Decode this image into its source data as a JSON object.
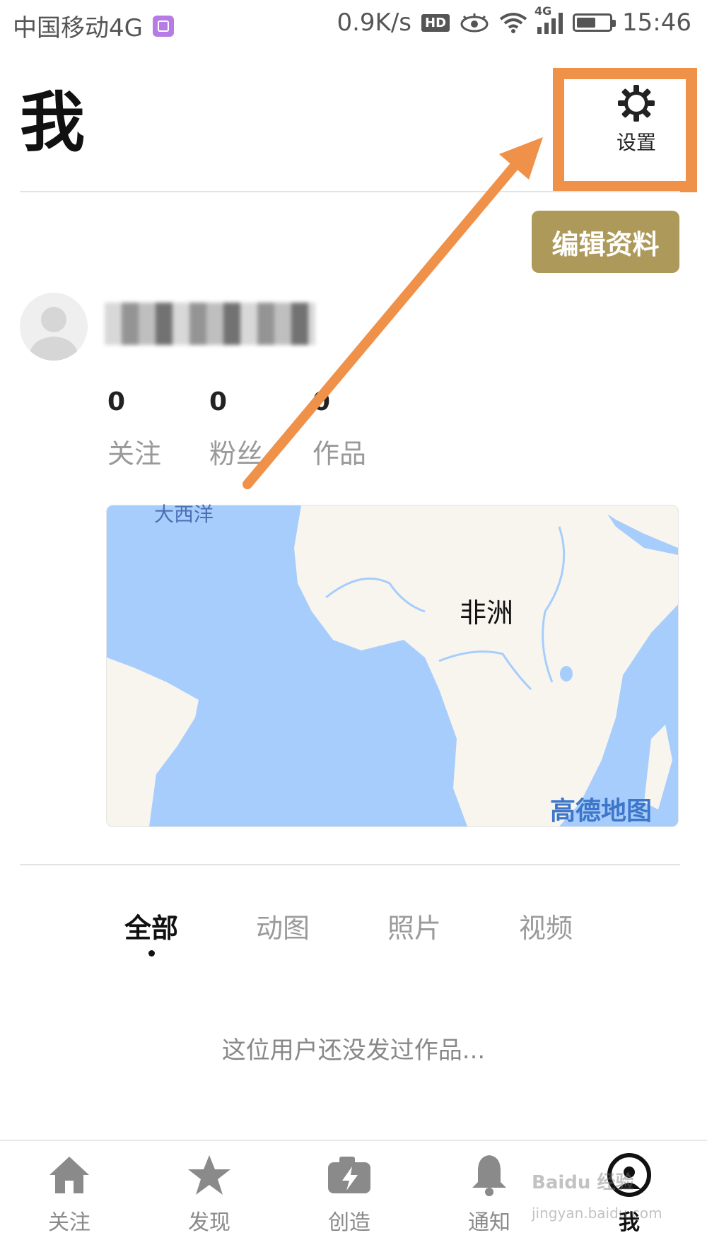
{
  "status_bar": {
    "carrier": "中国移动4G",
    "network_speed": "0.9K/s",
    "hd": "HD",
    "signal_type": "4G",
    "time": "15:46",
    "icons": [
      "gallery-icon",
      "hd-icon",
      "eye-icon",
      "wifi-icon",
      "signal-icon",
      "battery-icon"
    ]
  },
  "header": {
    "title": "我",
    "settings_label": "设置",
    "settings_icon": "gear-icon"
  },
  "profile": {
    "edit_button": "编辑资料",
    "stats": [
      {
        "value": "0",
        "label": "关注"
      },
      {
        "value": "0",
        "label": "粉丝"
      },
      {
        "value": "0",
        "label": "作品"
      }
    ]
  },
  "map": {
    "ocean_label": "大西洋",
    "region_label": "非洲",
    "brand": "高德地图",
    "colors": {
      "water": "#a7cdfd",
      "land": "#f8f5ef"
    }
  },
  "tabs": [
    {
      "label": "全部",
      "active": true
    },
    {
      "label": "动图",
      "active": false
    },
    {
      "label": "照片",
      "active": false
    },
    {
      "label": "视频",
      "active": false
    }
  ],
  "empty_message": "这位用户还没发过作品...",
  "bottom_nav": [
    {
      "label": "关注",
      "icon": "home-icon",
      "active": false
    },
    {
      "label": "发现",
      "icon": "star-icon",
      "active": false
    },
    {
      "label": "创造",
      "icon": "camera-bolt-icon",
      "active": false
    },
    {
      "label": "通知",
      "icon": "bell-icon",
      "active": false
    },
    {
      "label": "我",
      "icon": "user-circle-icon",
      "active": true
    }
  ],
  "watermark": {
    "text": "Baidu 经验",
    "sub": "jingyan.baidu.com"
  },
  "colors": {
    "highlight": "#f0914a",
    "edit_button": "#ad9a5b",
    "annotation_arrow": "#f0914a"
  }
}
